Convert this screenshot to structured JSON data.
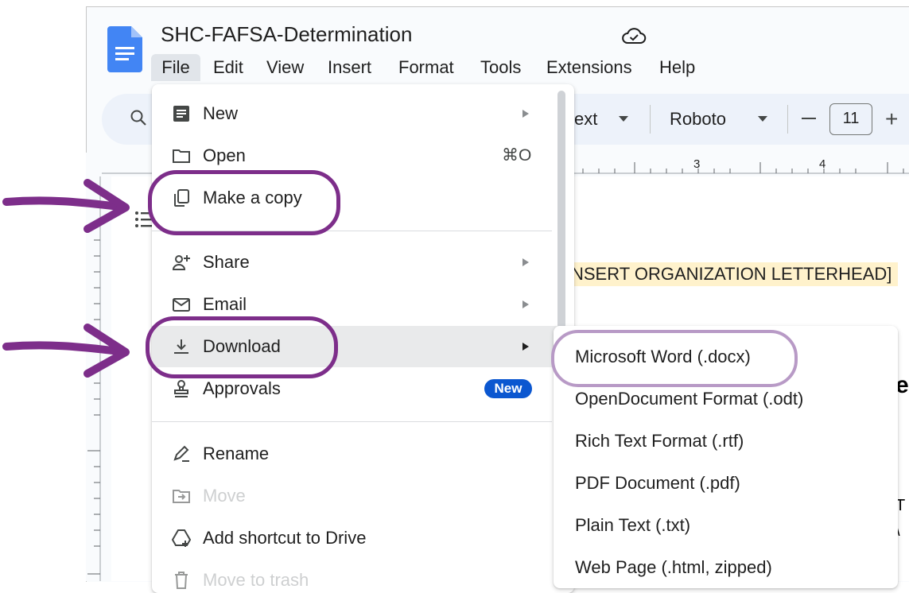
{
  "document": {
    "title": "SHC-FAFSA-Determination",
    "icon": "google-docs-icon",
    "save_status_icon": "cloud-check-icon"
  },
  "menubar": {
    "items": [
      "File",
      "Edit",
      "View",
      "Insert",
      "Format",
      "Tools",
      "Extensions",
      "Help"
    ],
    "active": "File"
  },
  "toolbar": {
    "style_partial": "ext",
    "font": "Roboto",
    "font_size": "11",
    "minus": "−",
    "plus": "+"
  },
  "ruler": {
    "labels": [
      "3",
      "4"
    ]
  },
  "page": {
    "letterhead": "NSERT ORGANIZATION LETTERHEAD]",
    "clipped_heading": "e",
    "clipped_lines": [
      "T",
      "\\"
    ]
  },
  "file_menu": {
    "items": [
      {
        "label": "New",
        "icon": "new-document-icon",
        "submenu": true
      },
      {
        "label": "Open",
        "icon": "folder-icon",
        "shortcut": "⌘O"
      },
      {
        "label": "Make a copy",
        "icon": "copy-icon"
      },
      {
        "label": "Share",
        "icon": "share-person-icon",
        "submenu": true
      },
      {
        "label": "Email",
        "icon": "email-icon",
        "submenu": true
      },
      {
        "label": "Download",
        "icon": "download-icon",
        "submenu": true,
        "highlighted": true
      },
      {
        "label": "Approvals",
        "icon": "approvals-icon",
        "badge": "New"
      },
      {
        "label": "Rename",
        "icon": "rename-icon"
      },
      {
        "label": "Move",
        "icon": "move-folder-icon",
        "disabled": true
      },
      {
        "label": "Add shortcut to Drive",
        "icon": "drive-shortcut-icon"
      },
      {
        "label": "Move to trash",
        "icon": "trash-icon",
        "disabled": true
      }
    ]
  },
  "download_submenu": {
    "items": [
      "Microsoft Word (.docx)",
      "OpenDocument Format (.odt)",
      "Rich Text Format (.rtf)",
      "PDF Document (.pdf)",
      "Plain Text (.txt)",
      "Web Page (.html, zipped)"
    ]
  },
  "annotations": {
    "ring_color": "#7d2e8a",
    "ring_light_color": "#b89ac6",
    "arrow_color": "#7d2e8a",
    "highlighted_items": [
      "Make a copy",
      "Download",
      "Microsoft Word (.docx)"
    ]
  }
}
